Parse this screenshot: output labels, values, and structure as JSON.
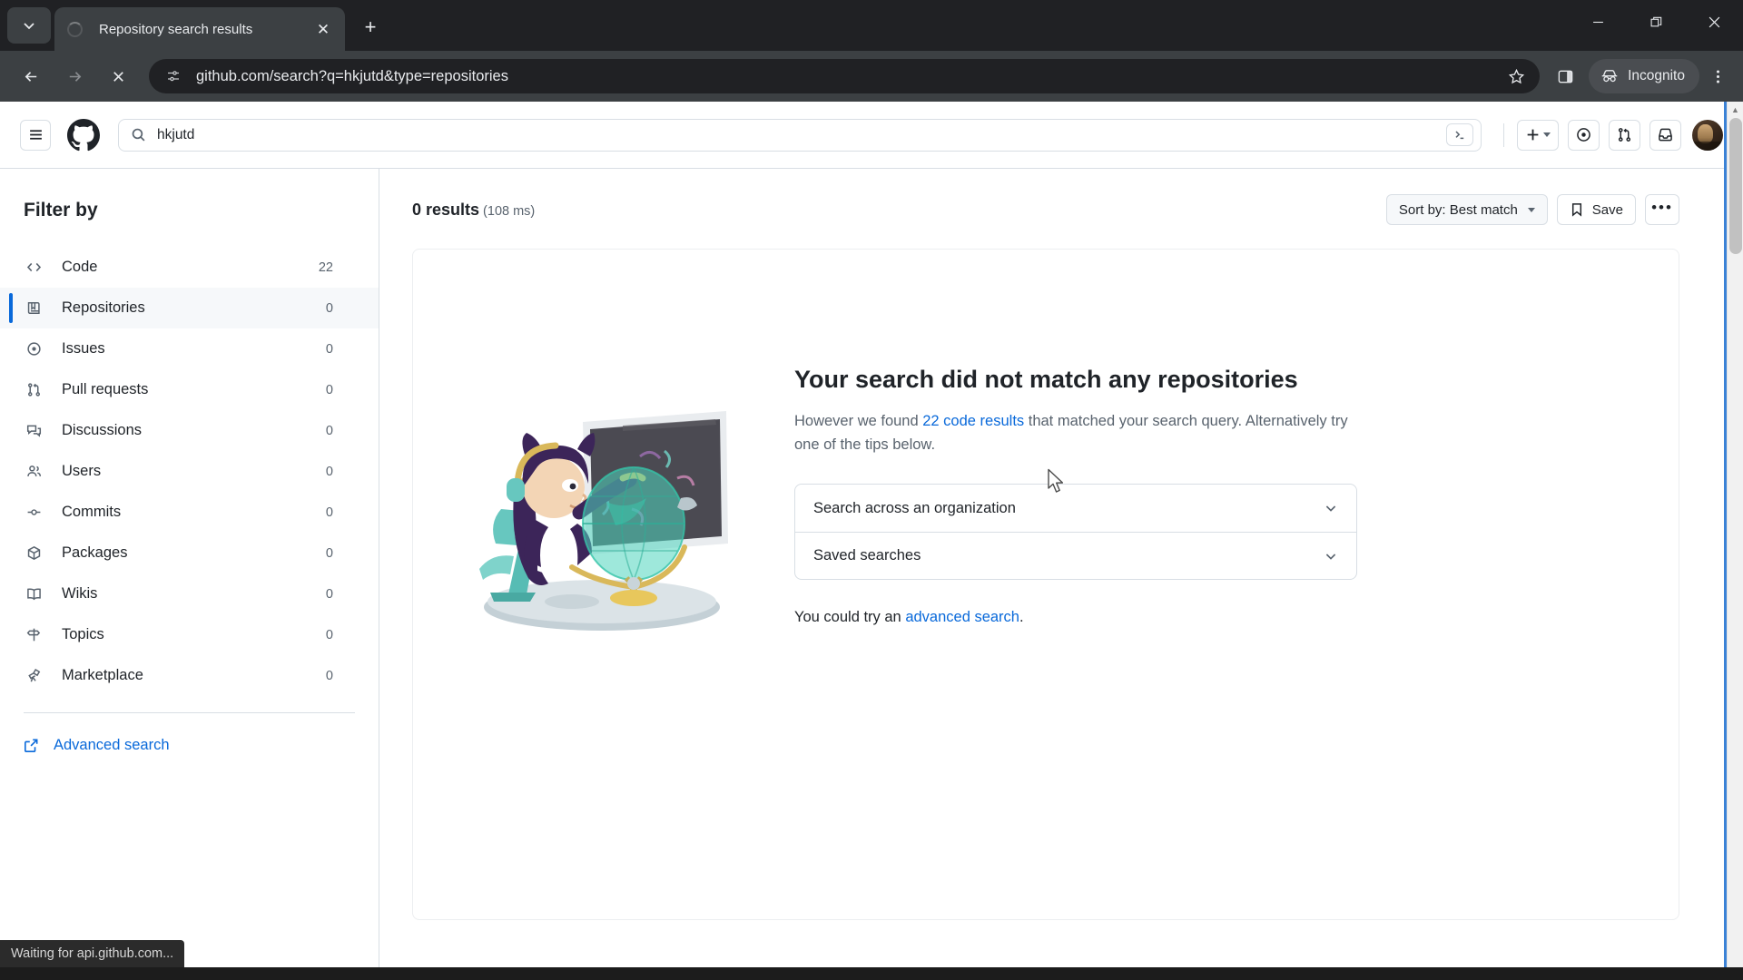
{
  "browser": {
    "tab": {
      "title": "Repository search results",
      "close_label": "✕",
      "favicon": "loading-spinner-icon"
    },
    "new_tab_label": "+",
    "tab_search_icon": "chevron-down-icon",
    "window_controls": {
      "minimize": "minimize-icon",
      "maximize": "restore-icon",
      "close": "close-icon"
    },
    "toolbar": {
      "back_icon": "arrow-left-icon",
      "forward_icon": "arrow-right-icon",
      "stop_icon": "stop-loading-icon",
      "site_info_icon": "tune-icon",
      "url": "github.com/search?q=hkjutd&type=repositories",
      "bookmark_icon": "star-icon",
      "side_panel_icon": "side-panel-icon",
      "incognito_label": "Incognito",
      "incognito_icon": "incognito-icon",
      "menu_icon": "kebab-menu-icon"
    }
  },
  "github": {
    "header": {
      "menu_icon": "hamburger-icon",
      "logo_icon": "github-mark-icon",
      "search_value": "hkjutd",
      "search_icon": "search-icon",
      "command_palette_icon": "terminal-prompt-icon",
      "create_new_icon": "plus-icon",
      "issues_icon": "issue-opened-icon",
      "pull_requests_icon": "git-pull-request-icon",
      "inbox_icon": "inbox-icon",
      "avatar_name": "user-avatar"
    },
    "sidebar": {
      "title": "Filter by",
      "items": [
        {
          "label": "Code",
          "count": "22",
          "icon": "code-icon",
          "active": false
        },
        {
          "label": "Repositories",
          "count": "0",
          "icon": "repo-icon",
          "active": true
        },
        {
          "label": "Issues",
          "count": "0",
          "icon": "issue-opened-icon",
          "active": false
        },
        {
          "label": "Pull requests",
          "count": "0",
          "icon": "git-pull-request-icon",
          "active": false
        },
        {
          "label": "Discussions",
          "count": "0",
          "icon": "comment-discussion-icon",
          "active": false
        },
        {
          "label": "Users",
          "count": "0",
          "icon": "people-icon",
          "active": false
        },
        {
          "label": "Commits",
          "count": "0",
          "icon": "git-commit-icon",
          "active": false
        },
        {
          "label": "Packages",
          "count": "0",
          "icon": "package-icon",
          "active": false
        },
        {
          "label": "Wikis",
          "count": "0",
          "icon": "book-icon",
          "active": false
        },
        {
          "label": "Topics",
          "count": "0",
          "icon": "topic-icon",
          "active": false
        },
        {
          "label": "Marketplace",
          "count": "0",
          "icon": "telescope-icon",
          "active": false
        }
      ],
      "advanced_search": "Advanced search",
      "advanced_search_icon": "link-external-icon"
    },
    "results": {
      "count_text": "0 results",
      "time_text": "(108 ms)",
      "sort_label": "Sort by: Best match",
      "save_label": "Save",
      "save_icon": "bookmark-icon",
      "more_label": "•••"
    },
    "blankslate": {
      "illustration_name": "mona-search-globe-illustration",
      "title": "Your search did not match any repositories",
      "body_before": "However we found ",
      "body_link": "22 code results",
      "body_after": " that matched your search query. Alternatively try one of the tips below.",
      "tips": [
        {
          "label": "Search across an organization",
          "chevron": "chevron-down-icon"
        },
        {
          "label": "Saved searches",
          "chevron": "chevron-down-icon"
        }
      ],
      "try_before": "You could try an ",
      "try_link": "advanced search",
      "try_after": "."
    }
  },
  "status_bar": {
    "text": "Waiting for api.github.com..."
  },
  "colors": {
    "accent": "#0969da",
    "chrome_dark": "#202124",
    "toolbar_dark": "#3c4043",
    "border": "#d8dee4",
    "muted_text": "#59636e"
  }
}
